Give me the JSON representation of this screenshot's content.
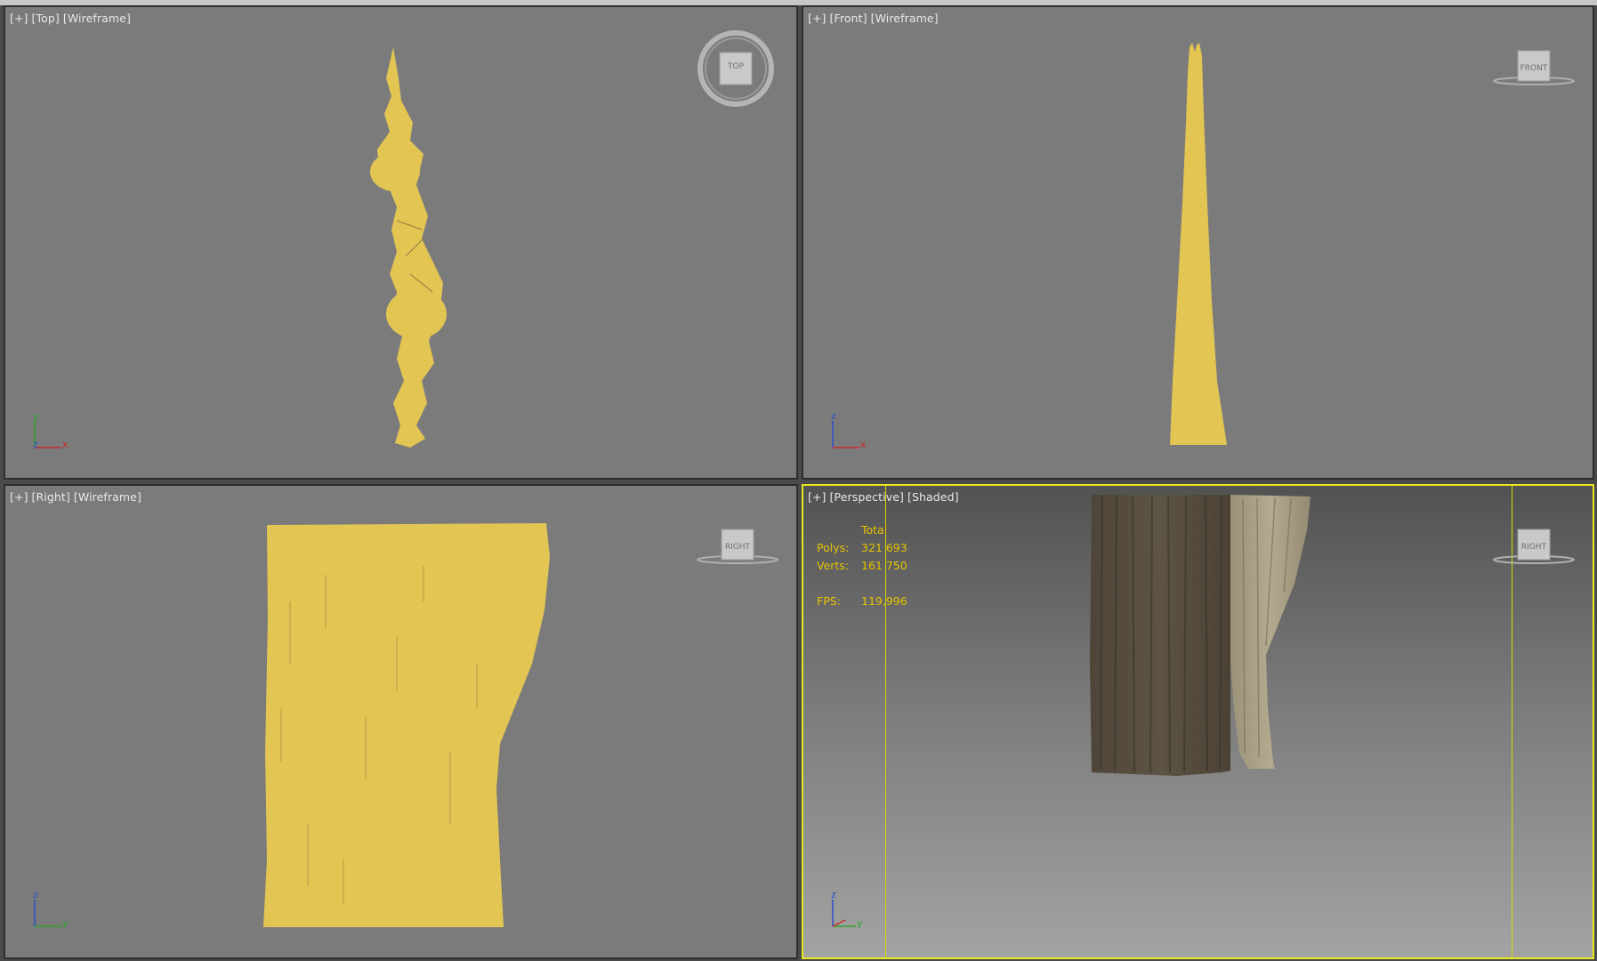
{
  "colors": {
    "viewport_bg": "#7b7b7b",
    "wire_yellow": "#e3c554",
    "active_border": "#e6e61e",
    "stats_text": "#e6c300",
    "label_text": "#e8e8e8"
  },
  "viewports": {
    "top": {
      "plus": "[+]",
      "name": "[Top]",
      "mode": "[Wireframe]",
      "cube_label": "TOP",
      "axis_a": "y",
      "axis_b": "x",
      "axis_c": "z"
    },
    "front": {
      "plus": "[+]",
      "name": "[Front]",
      "mode": "[Wireframe]",
      "cube_label": "FRONT",
      "axis_a": "z",
      "axis_b": "x"
    },
    "right": {
      "plus": "[+]",
      "name": "[Right]",
      "mode": "[Wireframe]",
      "cube_label": "RIGHT",
      "axis_a": "z",
      "axis_b": "y"
    },
    "persp": {
      "plus": "[+]",
      "name": "[Perspective]",
      "mode": "[Shaded]",
      "cube_label": "RIGHT",
      "axis_a": "z",
      "axis_b": "y"
    }
  },
  "stats": {
    "header": "Total",
    "polys_label": "Polys:",
    "polys_value": "321 693",
    "verts_label": "Verts:",
    "verts_value": "161 750",
    "fps_label": "FPS:",
    "fps_value": "119,996"
  }
}
